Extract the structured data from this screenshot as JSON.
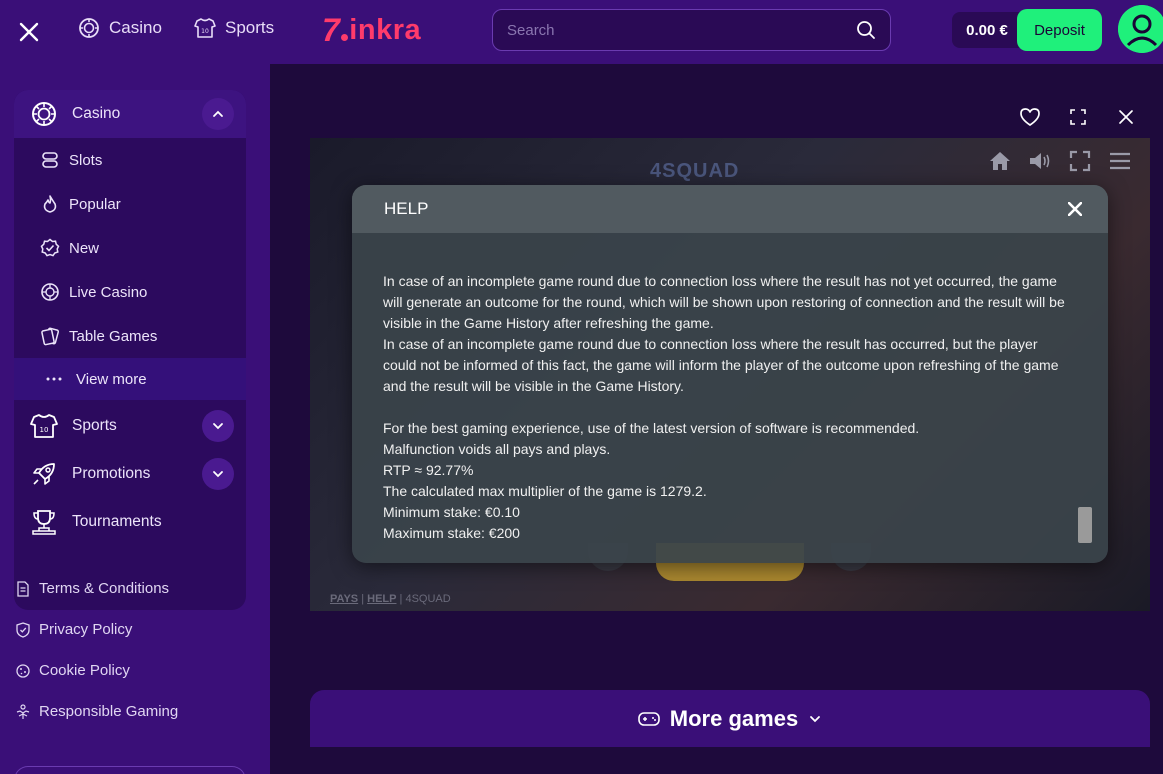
{
  "topbar": {
    "nav": [
      {
        "label": "Casino",
        "icon": "casino-chip-icon"
      },
      {
        "label": "Sports",
        "icon": "jersey-icon"
      }
    ],
    "logo": {
      "seven": "7",
      "rest": "inkra"
    },
    "search_placeholder": "Search",
    "balance": "0.00 €",
    "deposit_label": "Deposit"
  },
  "sidebar": {
    "casino": {
      "label": "Casino",
      "expanded": true
    },
    "items": [
      {
        "label": "Slots",
        "icon": "slots-icon"
      },
      {
        "label": "Popular",
        "icon": "flame-icon"
      },
      {
        "label": "New",
        "icon": "badge-check-icon"
      },
      {
        "label": "Live Casino",
        "icon": "roulette-icon"
      },
      {
        "label": "Table Games",
        "icon": "cards-icon"
      }
    ],
    "view_more": "View more",
    "groups": [
      {
        "label": "Sports",
        "icon": "jersey-icon"
      },
      {
        "label": "Promotions",
        "icon": "rocket-icon"
      },
      {
        "label": "Tournaments",
        "icon": "trophy-icon"
      }
    ],
    "footer": [
      {
        "label": "Terms & Conditions",
        "icon": "document-icon"
      },
      {
        "label": "Privacy Policy",
        "icon": "shield-icon"
      },
      {
        "label": "Cookie Policy",
        "icon": "cookie-icon"
      },
      {
        "label": "Responsible Gaming",
        "icon": "hands-icon"
      }
    ]
  },
  "game": {
    "title": "4SQUAD",
    "links": {
      "pays": "PAYS",
      "help": "HELP",
      "name": "4SQUAD",
      "sep": "|"
    },
    "help_panel": {
      "title": "HELP",
      "lines": [
        "In case of an incomplete game round due to connection loss where the result has not yet occurred, the game will generate an outcome for the round, which will be shown upon restoring of connection and the result will be visible in the Game History after refreshing the game.",
        "In case of an incomplete game round due to connection loss where the result has occurred, but the player could not be informed of this fact, the game will inform the player of the outcome upon refreshing of the game and the result will be visible in the Game History.",
        "",
        "For the best gaming experience, use of the latest version of software is recommended.",
        "Malfunction voids all pays and plays.",
        "RTP ≈ 92.77%",
        "The calculated max multiplier of the game is 1279.2.",
        "Minimum stake: €0.10",
        "Maximum stake: €200"
      ]
    }
  },
  "more_games_label": "More games",
  "colors": {
    "bg": "#1e0a3c",
    "panel": "#3a0f78",
    "accent_green": "#1ff07b",
    "logo_red": "#ff3b6b"
  }
}
